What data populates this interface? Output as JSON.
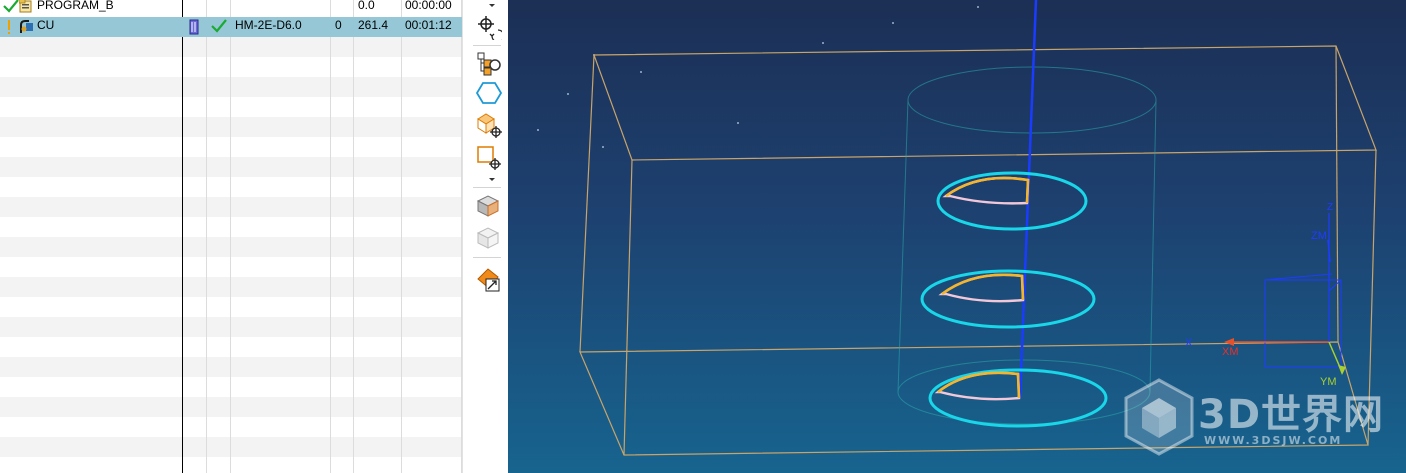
{
  "navigator": {
    "rows": [
      {
        "name": "PROGRAM_B",
        "path": "",
        "tool": "",
        "tool_number": "",
        "time_value": "0.0",
        "time": "00:00:00",
        "status_icon": "check-icon",
        "type_icon": "program-group-icon",
        "selected": false
      },
      {
        "name": "CU",
        "path": "",
        "tool": "HM-2E-D6.0",
        "tool_number": "0",
        "time_value": "261.4",
        "time": "00:01:12",
        "status_icon": "warning-icon",
        "type_icon": "cavity-mill-operation-icon",
        "path_icon": "toolpath-icon",
        "tool_status_icon": "check-icon",
        "selected": true
      }
    ],
    "empty_row_count": 21
  },
  "toolbar": {
    "icons": [
      "origin-rotate-icon",
      "geometry-view-icon",
      "hexagon-icon",
      "box-crosshair-icon",
      "selection-crosshair-icon",
      "shaded-box-icon",
      "wireframe-box-icon",
      "material-icon"
    ]
  },
  "viewport": {
    "axis_labels": {
      "x": "X",
      "xm": "XM",
      "z": "Z",
      "zm": "ZM",
      "ym": "YM"
    },
    "watermark": {
      "title": "3D世界网",
      "url": "WWW.3DSJW.COM"
    },
    "colors": {
      "background_top": "#1c2f55",
      "background_bottom": "#17648f",
      "stock_box": "#c8a46a",
      "circles": "#19d6e8",
      "toolpath_arc": "#f4b52c",
      "toolpath_return": "#f2c8d9",
      "tool_axis": "#1a3cff",
      "selection_row": "#96c7d6"
    }
  }
}
